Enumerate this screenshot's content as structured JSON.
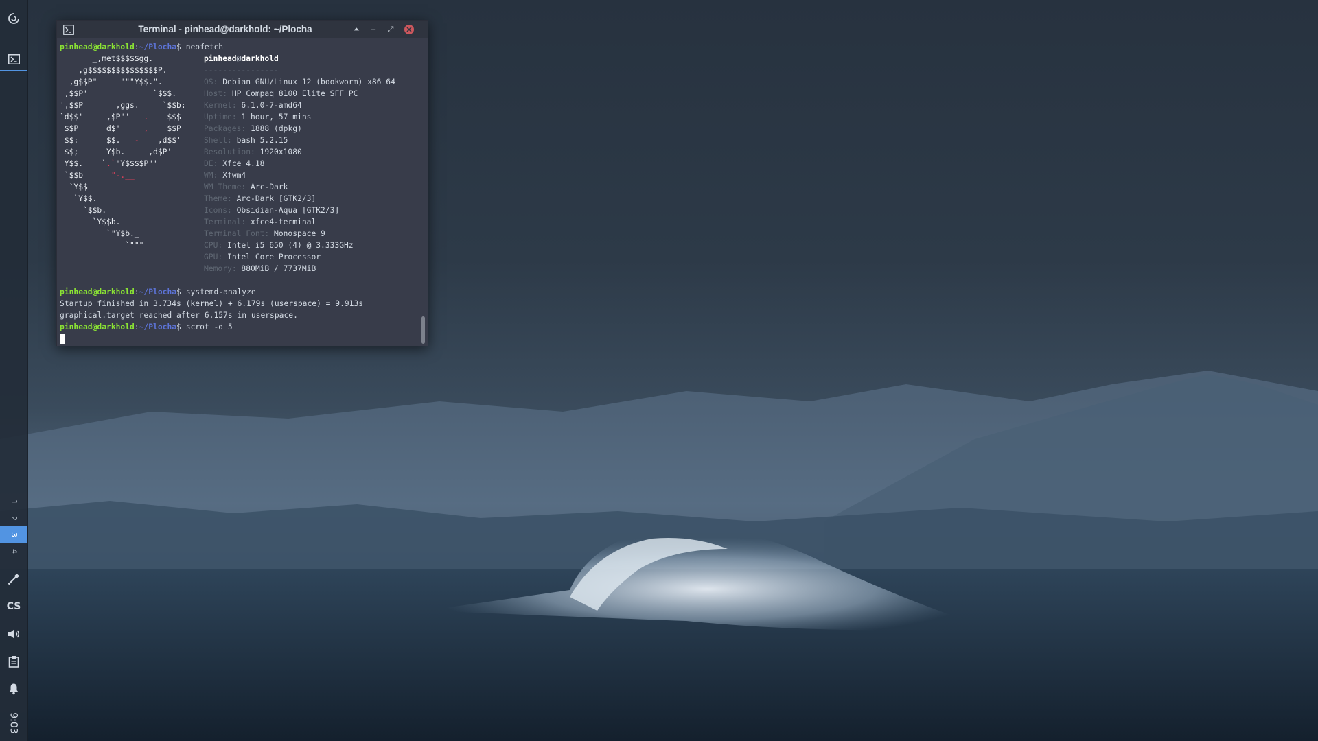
{
  "panel": {
    "launcher_icon": "power-swirl-icon",
    "terminal_task_icon": "terminal-icon",
    "workspaces": [
      "1",
      "2",
      "3",
      "4"
    ],
    "active_workspace": "3",
    "tray_icons": [
      "color-picker-icon",
      "keyboard-layout-indicator",
      "volume-icon",
      "clipboard-icon",
      "notification-bell-icon"
    ],
    "keyboard_layout": "CS",
    "clock": "9:03"
  },
  "terminal": {
    "title": "Terminal - pinhead@darkhold: ~/Plocha",
    "prompt_user": "pinhead@darkhold",
    "prompt_sep": ":",
    "prompt_path": "~/Plocha",
    "prompt_dollar": "$",
    "commands": {
      "c1": "neofetch",
      "c2": "systemd-analyze",
      "c3": "scrot -d 5"
    },
    "neofetch": {
      "header_user": "pinhead",
      "header_at": "@",
      "header_host": "darkhold",
      "separator": "----------------",
      "fields": [
        {
          "key": "OS",
          "value": "Debian GNU/Linux 12 (bookworm) x86_64"
        },
        {
          "key": "Host",
          "value": "HP Compaq 8100 Elite SFF PC"
        },
        {
          "key": "Kernel",
          "value": "6.1.0-7-amd64"
        },
        {
          "key": "Uptime",
          "value": "1 hour, 57 mins"
        },
        {
          "key": "Packages",
          "value": "1888 (dpkg)"
        },
        {
          "key": "Shell",
          "value": "bash 5.2.15"
        },
        {
          "key": "Resolution",
          "value": "1920x1080"
        },
        {
          "key": "DE",
          "value": "Xfce 4.18"
        },
        {
          "key": "WM",
          "value": "Xfwm4"
        },
        {
          "key": "WM Theme",
          "value": "Arc-Dark"
        },
        {
          "key": "Theme",
          "value": "Arc-Dark [GTK2/3]"
        },
        {
          "key": "Icons",
          "value": "Obsidian-Aqua [GTK2/3]"
        },
        {
          "key": "Terminal",
          "value": "xfce4-terminal"
        },
        {
          "key": "Terminal Font",
          "value": "Monospace 9"
        },
        {
          "key": "CPU",
          "value": "Intel i5 650 (4) @ 3.333GHz"
        },
        {
          "key": "GPU",
          "value": "Intel Core Processor"
        },
        {
          "key": "Memory",
          "value": "880MiB / 7737MiB"
        }
      ],
      "ascii": [
        "       _,met$$$$$gg.",
        "    ,g$$$$$$$$$$$$$$$P.",
        "  ,g$$P\"     \"\"\"Y$$.\".",
        " ,$$P'              `$$$.",
        "',$$P       ,ggs.     `$$b:",
        "`d$$'     ,$P\"'   .    $$$",
        " $$P      d$'     ,    $$P",
        " $$:      $$.   -    ,d$$'",
        " $$;      Y$b._   _,d$P'",
        " Y$$.    `.`\"Y$$$$P\"'",
        " `$$b      \"-.__",
        "  `Y$$",
        "   `Y$$.",
        "     `$$b.",
        "       `Y$$b.",
        "          `\"Y$b._",
        "              `\"\"\""
      ]
    },
    "output": {
      "line1": "Startup finished in 3.734s (kernel) + 6.179s (userspace) = 9.913s",
      "line2": "graphical.target reached after 6.157s in userspace."
    },
    "window_buttons": {
      "shade": "⏶",
      "minimize": "–",
      "maximize": "⤢",
      "close": "✕"
    }
  },
  "colors": {
    "panel_bg": "#232c38",
    "active_workspace": "#5294e2",
    "terminal_bg": "#383c4a",
    "titlebar": "#2f343f",
    "prompt_user": "#8ae234",
    "prompt_path": "#5c73d6",
    "debian_red": "#e0415a",
    "close_button": "#cc575d"
  }
}
